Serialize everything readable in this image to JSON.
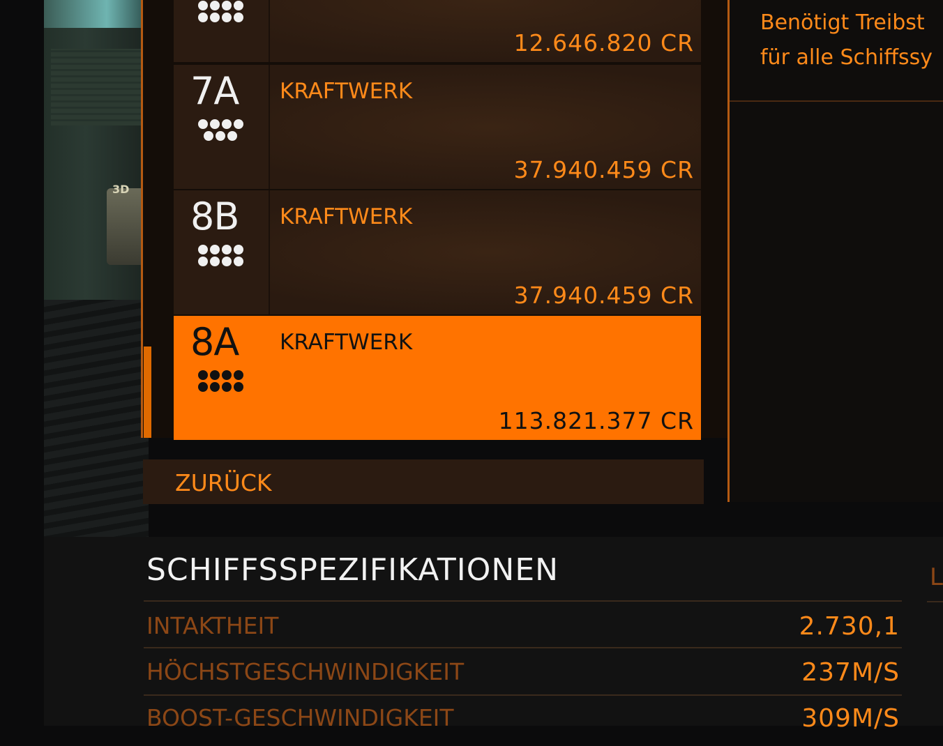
{
  "modules": [
    {
      "grade": "",
      "name": "",
      "price": "12.646.820 CR",
      "dots": [
        4,
        4
      ]
    },
    {
      "grade": "7A",
      "name": "KRAFTWERK",
      "price": "37.940.459 CR",
      "dots": [
        4,
        3
      ]
    },
    {
      "grade": "8B",
      "name": "KRAFTWERK",
      "price": "37.940.459 CR",
      "dots": [
        4,
        4
      ]
    },
    {
      "grade": "8A",
      "name": "KRAFTWERK",
      "price": "113.821.377 CR",
      "dots": [
        4,
        4
      ],
      "selected": true
    }
  ],
  "back_label": "ZURÜCK",
  "info": {
    "line1": "Benötigt Treibst",
    "line2": "für alle Schiffssy"
  },
  "specs": {
    "title": "SCHIFFSSPEZIFIKATIONEN",
    "rows": [
      {
        "label": "INTAKTHEIT",
        "value": "2.730,1"
      },
      {
        "label": "HÖCHSTGESCHWINDIGKEIT",
        "value": "237M/S"
      },
      {
        "label": "BOOST-GESCHWINDIGKEIT",
        "value": "309M/S"
      }
    ],
    "right_stub": "L"
  },
  "scene": {
    "badge": "3D"
  },
  "colors": {
    "accent": "#ff7300",
    "text_orange": "#ff8a1a",
    "frame": "#b55a12"
  }
}
